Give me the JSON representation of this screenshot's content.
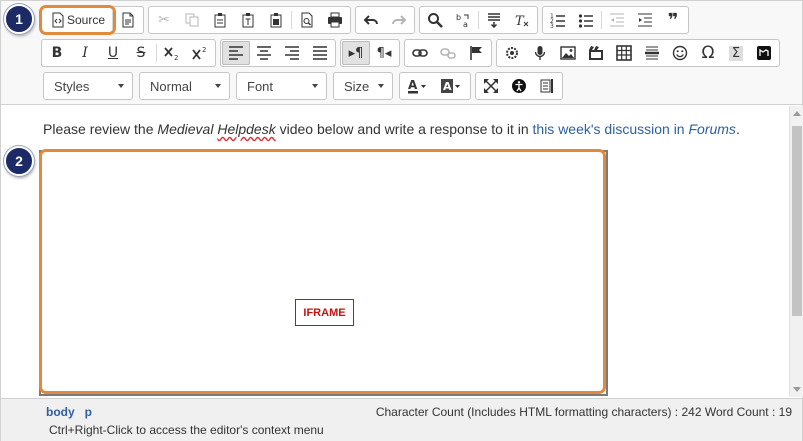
{
  "toolbar": {
    "source_label": "Source",
    "combos": {
      "styles": "Styles",
      "format": "Normal",
      "font": "Font",
      "size": "Size"
    },
    "row1_icons": [
      "new-page-icon",
      "cut-icon",
      "copy-icon",
      "paste-icon",
      "paste-text-icon",
      "paste-word-icon",
      "preview-icon",
      "print-icon",
      "undo-icon",
      "redo-icon",
      "find-icon",
      "replace-icon",
      "show-blocks-icon",
      "remove-format-icon",
      "numbered-list-icon",
      "bulleted-list-icon",
      "outdent-icon",
      "indent-icon",
      "blockquote-icon"
    ],
    "row2_icons": [
      "bold-icon",
      "italic-icon",
      "underline-icon",
      "strikethrough-icon",
      "subscript-icon",
      "superscript-icon",
      "align-left-icon",
      "align-center-icon",
      "align-right-icon",
      "justify-icon",
      "ltr-icon",
      "rtl-icon",
      "link-icon",
      "unlink-icon",
      "anchor-icon",
      "media-embed-icon",
      "audio-icon",
      "image-icon",
      "video-icon",
      "table-icon",
      "horizontal-rule-icon",
      "smiley-icon",
      "special-char-icon",
      "math-icon",
      "widget-icon"
    ],
    "row3_icons": [
      "text-color-icon",
      "background-color-icon",
      "maximize-icon",
      "accessibility-icon",
      "template-icon"
    ]
  },
  "content": {
    "para_prefix": "Please review the ",
    "para_em1": "Medieval",
    "para_em2": "Helpdesk",
    "para_middle": " video below and write a response to it in ",
    "para_link1": "this week's discussion in ",
    "para_link2": "Forums",
    "para_suffix": ".",
    "iframe_label": "IFRAME"
  },
  "status": {
    "path": [
      "body",
      "p"
    ],
    "count": "Character Count (Includes HTML formatting characters) : 242 Word Count : 19",
    "hint": "Ctrl+Right-Click to access the editor's context menu"
  },
  "callouts": [
    "1",
    "2"
  ],
  "colors": {
    "callout_ring": "#e08b3c",
    "badge": "#1c2a66",
    "iframe_label": "#c41212",
    "link": "#2f5f9e"
  }
}
